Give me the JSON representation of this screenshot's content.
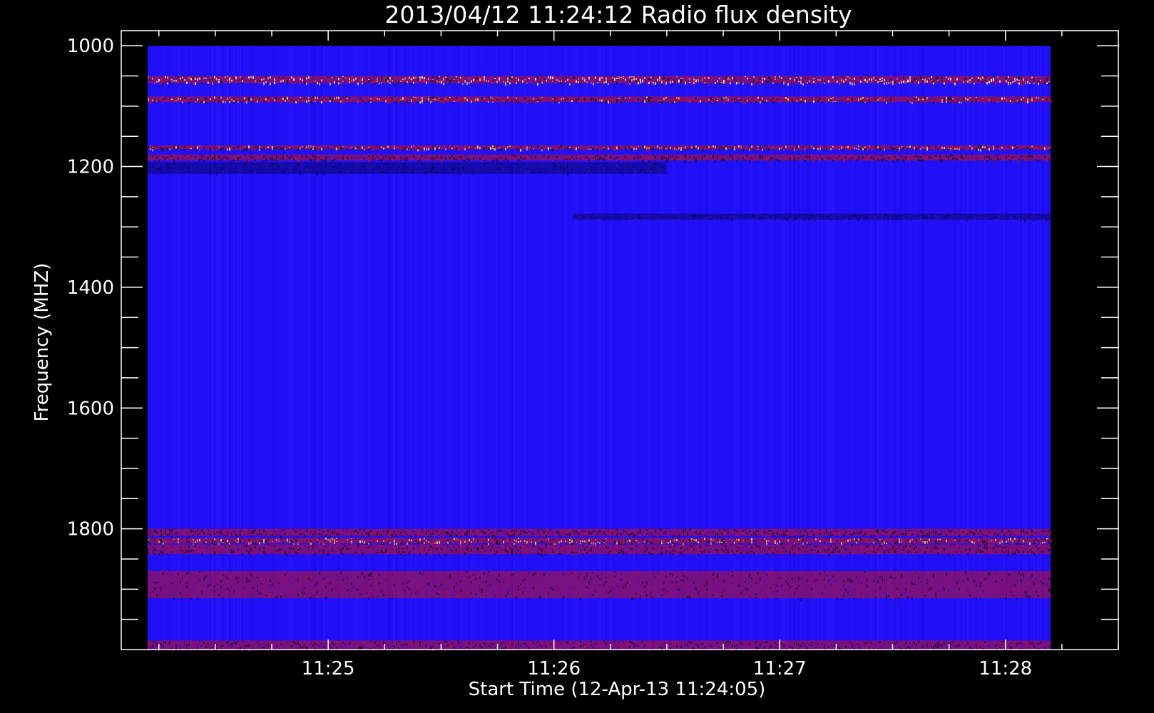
{
  "chart_data": {
    "type": "heatmap",
    "title": "2013/04/12 11:24:12 Radio flux density",
    "xlabel": "Start Time (12-Apr-13 11:24:05)",
    "ylabel": "Frequency (MHZ)",
    "x_axis": {
      "unit": "time (HH:MM)",
      "range": [
        "11:24:05",
        "11:28:30"
      ],
      "data_extent": [
        "11:24:12",
        "11:28:12"
      ],
      "tick_labels": [
        "11:25",
        "11:26",
        "11:27",
        "11:28"
      ],
      "major_ticks": [
        "11:25",
        "11:26",
        "11:27",
        "11:28"
      ],
      "minor_ticks_per_minute": 3
    },
    "y_axis": {
      "unit": "MHz",
      "range": [
        975,
        2000
      ],
      "data_extent": [
        1000,
        2000
      ],
      "inverted": true,
      "tick_labels": [
        "1000",
        "1200",
        "1400",
        "1600",
        "1800"
      ],
      "major_ticks": [
        1000,
        1200,
        1400,
        1600,
        1800
      ],
      "minor_tick_step": 50
    },
    "colormap": {
      "background": "#2010f8",
      "low": "#000010",
      "mid": "#c01020",
      "high": "#ffe060",
      "peak": "#ffffff"
    },
    "features": [
      {
        "kind": "band",
        "freq": [
          1050,
          1062
        ],
        "t": [
          "11:24:12",
          "11:28:12"
        ],
        "intensity": "very high"
      },
      {
        "kind": "band",
        "freq": [
          1084,
          1093
        ],
        "t": [
          "11:24:12",
          "11:28:12"
        ],
        "intensity": "high"
      },
      {
        "kind": "band",
        "freq": [
          1165,
          1171
        ],
        "t": [
          "11:24:12",
          "11:28:12"
        ],
        "intensity": "high"
      },
      {
        "kind": "band",
        "freq": [
          1180,
          1190
        ],
        "t": [
          "11:24:12",
          "11:28:12"
        ],
        "intensity": "medium"
      },
      {
        "kind": "band",
        "freq": [
          1193,
          1212
        ],
        "t": [
          "11:24:12",
          "11:26:30"
        ],
        "intensity": "low"
      },
      {
        "kind": "band",
        "freq": [
          1278,
          1288
        ],
        "t": [
          "11:26:05",
          "11:28:12"
        ],
        "intensity": "low"
      },
      {
        "kind": "band",
        "freq": [
          1800,
          1812
        ],
        "t": [
          "11:24:12",
          "11:28:12"
        ],
        "intensity": "medium"
      },
      {
        "kind": "band",
        "freq": [
          1815,
          1824
        ],
        "t": [
          "11:24:12",
          "11:28:12"
        ],
        "intensity": "high"
      },
      {
        "kind": "band",
        "freq": [
          1826,
          1842
        ],
        "t": [
          "11:24:12",
          "11:28:12"
        ],
        "intensity": "medium"
      },
      {
        "kind": "band",
        "freq": [
          1870,
          1915
        ],
        "t": [
          "11:24:12",
          "11:28:12"
        ],
        "intensity": "medium"
      },
      {
        "kind": "band",
        "freq": [
          1985,
          2000
        ],
        "t": [
          "11:24:12",
          "11:28:12"
        ],
        "intensity": "medium"
      }
    ]
  }
}
